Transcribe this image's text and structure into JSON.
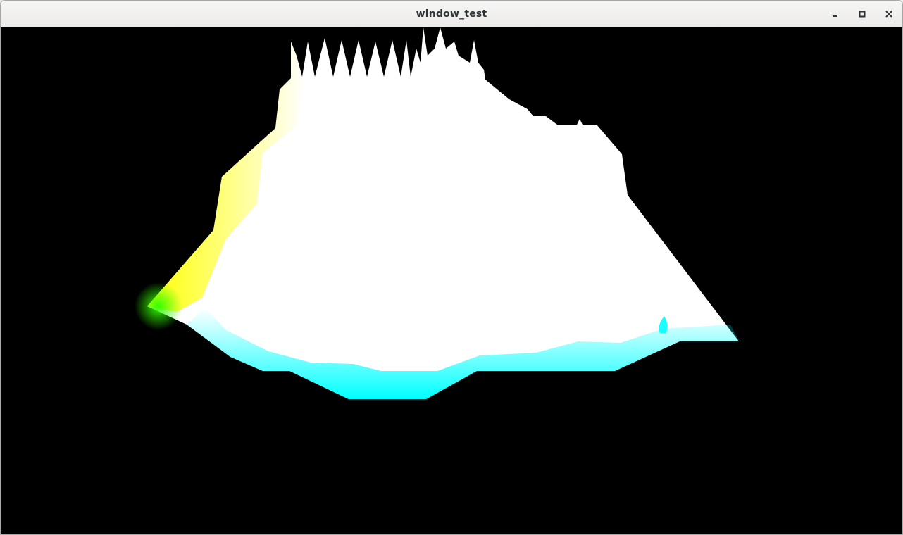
{
  "window": {
    "title": "window_test",
    "controls": {
      "minimize_icon": "minimize-icon",
      "maximize_icon": "maximize-icon",
      "close_icon": "close-icon"
    }
  },
  "scene": {
    "background_color": "#000000",
    "terrain_colors": {
      "top": "#ffffff",
      "left_edge": "#ffff00",
      "bottom_edge": "#00ffff",
      "corner": "#33ff00"
    }
  }
}
